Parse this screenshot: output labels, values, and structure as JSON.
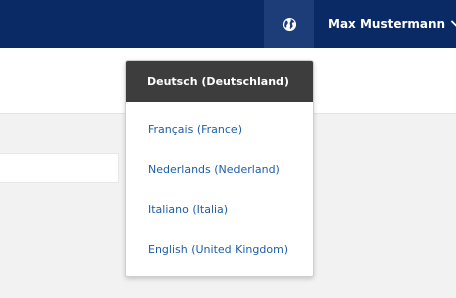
{
  "header": {
    "user_name": "Max Mustermann",
    "globe_icon": "globe-icon",
    "chevron_icon": "chevron-down-icon"
  },
  "language_menu": {
    "selected": "Deutsch (Deutschland)",
    "options": [
      "Français (France)",
      "Nederlands (Nederland)",
      "Italiano (Italia)",
      "English (United Kingdom)"
    ]
  },
  "colors": {
    "header_bg": "#0a2a66",
    "globe_btn_bg": "#1c3d78",
    "selected_bg": "#3d3d3d",
    "link": "#1d5ea8"
  }
}
